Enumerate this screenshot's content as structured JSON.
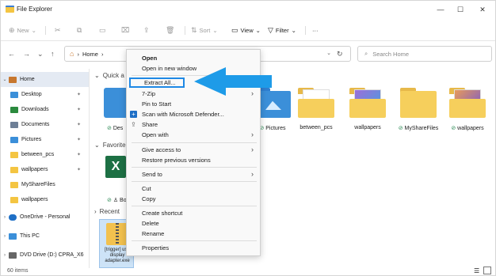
{
  "window": {
    "title": "File Explorer",
    "controls": [
      "—",
      "☐",
      "✕"
    ]
  },
  "toolbar": {
    "new_label": "New",
    "sort_label": "Sort",
    "view_label": "View",
    "filter_label": "Filter",
    "more_label": "···"
  },
  "address": {
    "breadcrumb": "Home",
    "search_placeholder": "Search Home"
  },
  "sidebar": {
    "items": [
      {
        "label": "Home",
        "expand": "⌄",
        "color": "#c7772e"
      },
      {
        "label": "Desktop",
        "color": "#3b8fd9"
      },
      {
        "label": "Downloads",
        "color": "#2b8a3e"
      },
      {
        "label": "Documents",
        "color": "#6d7f96"
      },
      {
        "label": "Pictures",
        "color": "#3b8fd9"
      },
      {
        "label": "between_pcs",
        "color": "#f4c542"
      },
      {
        "label": "wallpapers",
        "color": "#f4c542"
      },
      {
        "label": "MyShareFiles",
        "color": "#f4c542"
      },
      {
        "label": "wallpapers",
        "color": "#f4c542"
      },
      {
        "label": "OneDrive - Personal",
        "expand": "›",
        "color": "#1e6fc6"
      },
      {
        "label": "This PC",
        "expand": "›",
        "color": "#3b8fd9"
      },
      {
        "label": "DVD Drive (D:) CPRA_X6",
        "expand": "›",
        "color": "#666"
      }
    ]
  },
  "content": {
    "quick_access": "Quick a",
    "favorites": "Favorite",
    "recent": "Recent",
    "tiles": [
      {
        "label": "Des"
      },
      {
        "label": "Pictures"
      },
      {
        "label": "between_pcs"
      },
      {
        "label": "wallpapers"
      },
      {
        "label": "MyShareFiles"
      },
      {
        "label": "wallpapers"
      }
    ],
    "favorite_label": "Boo",
    "recent_file": "[trigger] usb display adapter.exe"
  },
  "status": {
    "count": "60 items"
  },
  "context_menu": {
    "items": [
      {
        "label": "Open"
      },
      {
        "label": "Open in new window"
      },
      {
        "label": "Extract All..."
      },
      {
        "label": "7-Zip"
      },
      {
        "label": "Pin to Start"
      },
      {
        "label": "Scan with Microsoft Defender..."
      },
      {
        "label": "Share"
      },
      {
        "label": "Open with"
      },
      {
        "label": "Give access to"
      },
      {
        "label": "Restore previous versions"
      },
      {
        "label": "Send to"
      },
      {
        "label": "Cut"
      },
      {
        "label": "Copy"
      },
      {
        "label": "Create shortcut"
      },
      {
        "label": "Delete"
      },
      {
        "label": "Rename"
      },
      {
        "label": "Properties"
      }
    ]
  },
  "colors": {
    "accent": "#1e88e5",
    "arrow": "#1e9be8"
  }
}
